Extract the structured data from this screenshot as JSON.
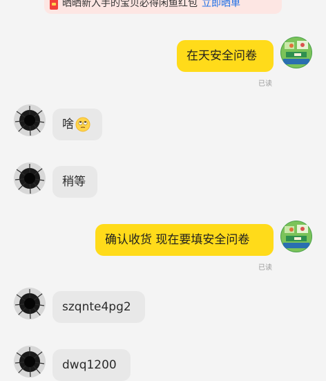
{
  "banner": {
    "text": "晒晒新入手的宝贝必得闲鱼红包",
    "link": "立即晒单"
  },
  "messages": [
    {
      "sender": "me",
      "text": "在天安全问卷",
      "status": "已读"
    },
    {
      "sender": "other",
      "text": "啥",
      "emoji": "rolling-eyes-emoji"
    },
    {
      "sender": "other",
      "text": "稍等"
    },
    {
      "sender": "me",
      "text": "确认收货 现在要填安全问卷",
      "status": "已读"
    },
    {
      "sender": "other",
      "text": "szqnte4pg2"
    },
    {
      "sender": "other",
      "text": "dwq1200"
    }
  ],
  "colors": {
    "background": "#f4f4f4",
    "my_bubble": "#ffdb1a",
    "other_bubble": "#e8e8e8",
    "banner_bg": "#fde6e3",
    "banner_link": "#1f6fe6"
  }
}
